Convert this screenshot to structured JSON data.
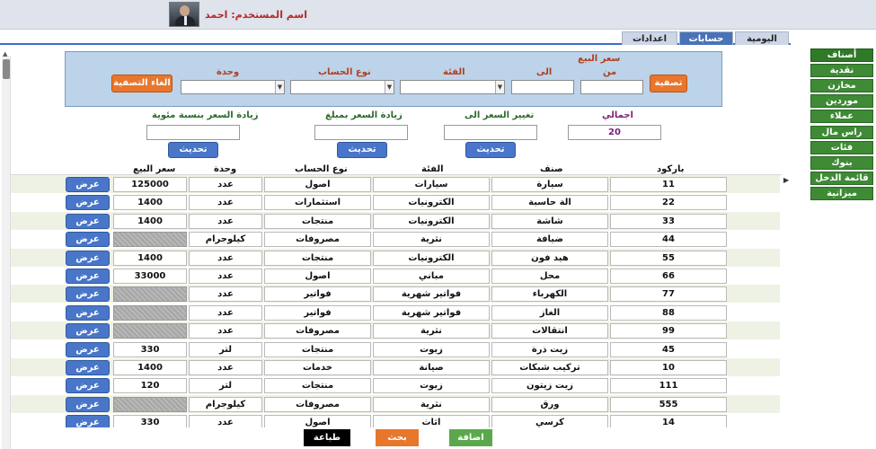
{
  "header": {
    "user_label": "اسم المستخدم: احمد"
  },
  "tabs": [
    {
      "label": "اليومية",
      "active": false
    },
    {
      "label": "حسابات",
      "active": true
    },
    {
      "label": "اعدادات",
      "active": false
    }
  ],
  "filter": {
    "sale_price_label": "سعر البيع",
    "from_label": "من",
    "to_label": "الى",
    "from_value": "",
    "to_value": "",
    "category_label": "الفئة",
    "category_value": "",
    "account_type_label": "نوع الحساب",
    "account_type_value": "",
    "unit_label": "وحدة",
    "unit_value": "",
    "filter_button": "تصفية",
    "cancel_filter_button": "الغاء التصفية"
  },
  "price_change": {
    "total_label": "اجمالي",
    "total_value": "20",
    "change_to_label": "تغيير السعر الى",
    "change_to_value": "",
    "increase_amount_label": "زيادة السعر بمبلغ",
    "increase_amount_value": "",
    "increase_percent_label": "زيادة السعر بنسبة مئوية",
    "increase_percent_value": "",
    "update_button": "تحديث"
  },
  "table": {
    "columns": {
      "barcode": "باركود",
      "item": "صنف",
      "category": "الفئة",
      "account_type": "نوع الحساب",
      "unit": "وحدة",
      "price": "سعر البيع"
    },
    "view_button": "عرض",
    "rows": [
      {
        "barcode": "11",
        "item": "سيارة",
        "category": "سيارات",
        "account_type": "اصول",
        "unit": "عدد",
        "price": "125000"
      },
      {
        "barcode": "22",
        "item": "الة حاسبة",
        "category": "الكترونيات",
        "account_type": "استثمارات",
        "unit": "عدد",
        "price": "1400"
      },
      {
        "barcode": "33",
        "item": "شاشة",
        "category": "الكترونيات",
        "account_type": "منتجات",
        "unit": "عدد",
        "price": "1400"
      },
      {
        "barcode": "44",
        "item": "ضيافة",
        "category": "نثرية",
        "account_type": "مصروفات",
        "unit": "كيلوجرام",
        "price": ""
      },
      {
        "barcode": "55",
        "item": "هيد فون",
        "category": "الكترونيات",
        "account_type": "منتجات",
        "unit": "عدد",
        "price": "1400"
      },
      {
        "barcode": "66",
        "item": "محل",
        "category": "مباني",
        "account_type": "اصول",
        "unit": "عدد",
        "price": "33000"
      },
      {
        "barcode": "77",
        "item": "الكهرباء",
        "category": "فواتير شهرية",
        "account_type": "فواتير",
        "unit": "عدد",
        "price": ""
      },
      {
        "barcode": "88",
        "item": "الغاز",
        "category": "فواتير شهرية",
        "account_type": "فواتير",
        "unit": "عدد",
        "price": ""
      },
      {
        "barcode": "99",
        "item": "انتقالات",
        "category": "نثرية",
        "account_type": "مصروفات",
        "unit": "عدد",
        "price": ""
      },
      {
        "barcode": "45",
        "item": "زيت ذرة",
        "category": "زيوت",
        "account_type": "منتجات",
        "unit": "لتر",
        "price": "330"
      },
      {
        "barcode": "10",
        "item": "تركيب شبكات",
        "category": "صيانة",
        "account_type": "خدمات",
        "unit": "عدد",
        "price": "1400"
      },
      {
        "barcode": "111",
        "item": "زيت زيتون",
        "category": "زيوت",
        "account_type": "منتجات",
        "unit": "لتر",
        "price": "120"
      },
      {
        "barcode": "555",
        "item": "ورق",
        "category": "نثرية",
        "account_type": "مصروفات",
        "unit": "كيلوجرام",
        "price": ""
      },
      {
        "barcode": "14",
        "item": "كرسي",
        "category": "اثاث",
        "account_type": "اصول",
        "unit": "عدد",
        "price": "330"
      }
    ]
  },
  "bottom": {
    "print": "طباعة",
    "search": "بحث",
    "add": "اضافة"
  },
  "sidebar": {
    "items": [
      "أصناف",
      "نقدية",
      "مخازن",
      "موردين",
      "عملاء",
      "راس مال",
      "فئات",
      "بنوك",
      "قائمة الدخل",
      "ميزانية"
    ]
  },
  "colors": {
    "accent_blue": "#4a76c9",
    "accent_orange": "#e8762b",
    "accent_green": "#3e8a35",
    "panel_blue": "#bcd3ea",
    "row_alt": "#eef2e4"
  }
}
